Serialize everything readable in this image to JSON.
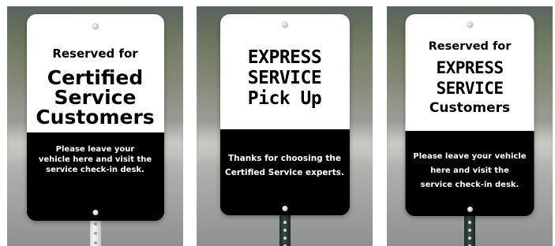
{
  "signs": [
    {
      "heading_lines": [
        "Reserved for",
        "Certified",
        "Service",
        "Customers"
      ],
      "message_lines": [
        "Please leave your",
        "vehicle here and visit the",
        "service check-in desk."
      ]
    },
    {
      "heading_lines": [
        "EXPRESS",
        "SERVICE",
        "Pick Up"
      ],
      "message_lines": [
        "Thanks for choosing the",
        "Certified Service experts."
      ]
    },
    {
      "heading_lines": [
        "Reserved for",
        "EXPRESS",
        "SERVICE",
        "Customers"
      ],
      "message_lines": [
        "Please leave your vehicle",
        "here and visit the",
        "service check-in desk."
      ]
    }
  ],
  "colors": {
    "sign_top": "#ffffff",
    "sign_bottom": "#000000",
    "text_dark": "#000000",
    "text_light": "#ffffff",
    "post_left": "#d9dad7",
    "post_mid_right": "#2f3b34"
  }
}
